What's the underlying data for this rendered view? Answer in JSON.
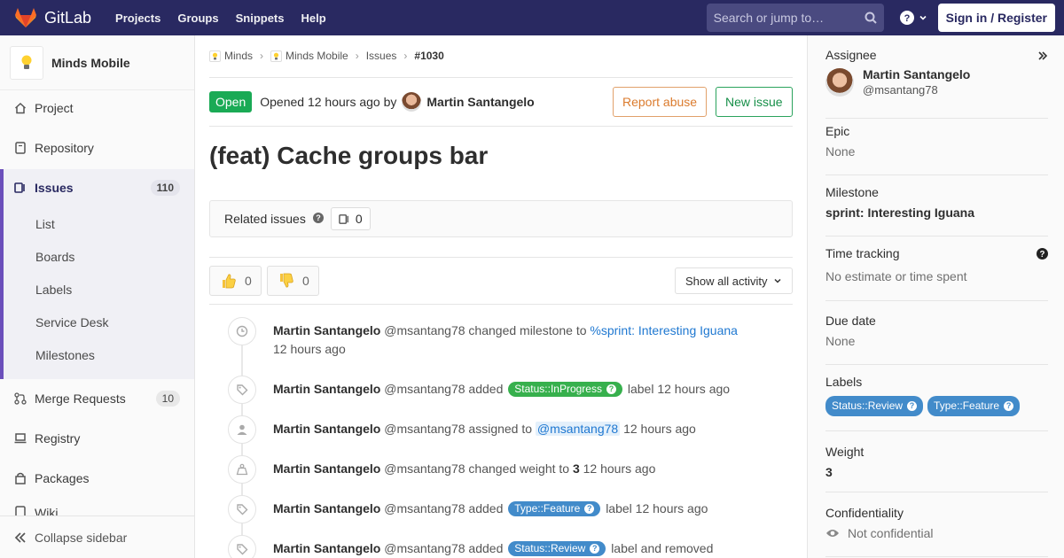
{
  "topnav": {
    "brand": "GitLab",
    "links": [
      "Projects",
      "Groups",
      "Snippets",
      "Help"
    ],
    "search_placeholder": "Search or jump to…",
    "signin": "Sign in / Register"
  },
  "sidebar": {
    "project_name": "Minds Mobile",
    "items": {
      "project": "Project",
      "repository": "Repository",
      "issues": "Issues",
      "issues_count": "110",
      "merge_requests": "Merge Requests",
      "mr_count": "10",
      "registry": "Registry",
      "packages": "Packages",
      "wiki": "Wiki"
    },
    "sub_items": [
      "List",
      "Boards",
      "Labels",
      "Service Desk",
      "Milestones"
    ],
    "collapse": "Collapse sidebar"
  },
  "breadcrumb": [
    "Minds",
    "Minds Mobile",
    "Issues",
    "#1030"
  ],
  "issue": {
    "status": "Open",
    "opened_text": "Opened 12 hours ago by",
    "author": "Martin Santangelo",
    "report_abuse": "Report abuse",
    "new_issue": "New issue",
    "title": "(feat) Cache groups bar",
    "related_label": "Related issues",
    "related_count": "0",
    "thumbs_up": "0",
    "thumbs_down": "0",
    "activity_filter": "Show all activity"
  },
  "timeline": [
    {
      "author": "Martin Santangelo",
      "handle": "@msantang78",
      "pre": "changed milestone to",
      "link": "%sprint: Interesting Iguana",
      "time": "12 hours ago"
    },
    {
      "author": "Martin Santangelo",
      "handle": "@msantang78",
      "pre": "added",
      "label": "Status::InProgress",
      "post": "label 12 hours ago"
    },
    {
      "author": "Martin Santangelo",
      "handle": "@msantang78",
      "pre": "assigned to",
      "mention": "@msantang78",
      "post": "12 hours ago"
    },
    {
      "author": "Martin Santangelo",
      "handle": "@msantang78",
      "pre": "changed weight to",
      "value": "3",
      "post": "12 hours ago"
    },
    {
      "author": "Martin Santangelo",
      "handle": "@msantang78",
      "pre": "added",
      "label": "Type::Feature",
      "post": "label 12 hours ago"
    },
    {
      "author": "Martin Santangelo",
      "handle": "@msantang78",
      "pre": "added",
      "label": "Status::Review",
      "post": "label and removed"
    }
  ],
  "right_sidebar": {
    "assignee_title": "Assignee",
    "assignee_name": "Martin Santangelo",
    "assignee_handle": "@msantang78",
    "epic_title": "Epic",
    "epic_value": "None",
    "milestone_title": "Milestone",
    "milestone_value": "sprint: Interesting Iguana",
    "time_title": "Time tracking",
    "time_value": "No estimate or time spent",
    "due_title": "Due date",
    "due_value": "None",
    "labels_title": "Labels",
    "labels": [
      "Status::Review",
      "Type::Feature"
    ],
    "weight_title": "Weight",
    "weight_value": "3",
    "conf_title": "Confidentiality",
    "conf_value": "Not confidential"
  },
  "colors": {
    "nav_bg": "#292961",
    "open_green": "#1aaa55",
    "label_inprogress": "#37b04d",
    "label_blue": "#428bca",
    "link_blue": "#1f78d1"
  }
}
